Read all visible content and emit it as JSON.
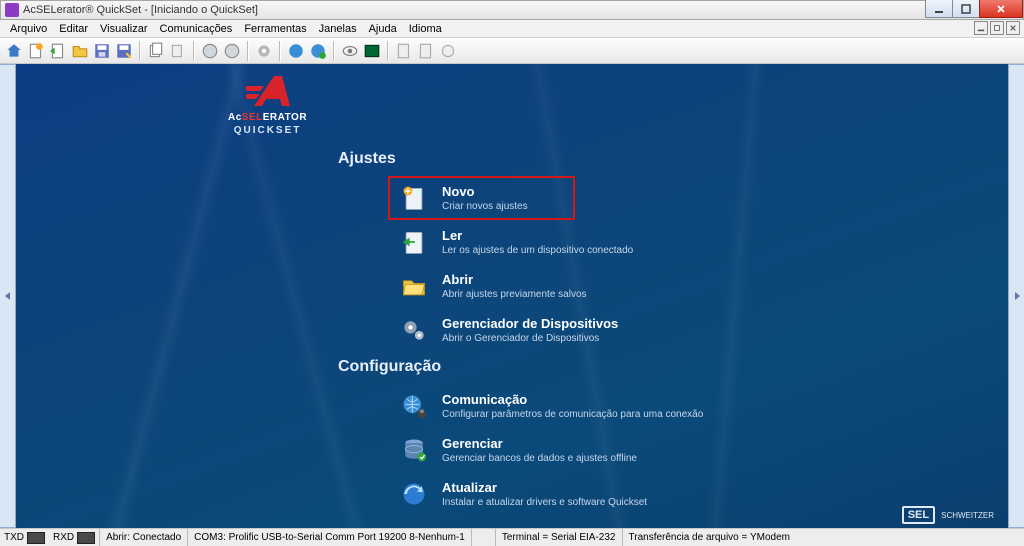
{
  "titlebar": {
    "text": "AcSELerator® QuickSet - [Iniciando o QuickSet]"
  },
  "menu": {
    "arquivo": "Arquivo",
    "editar": "Editar",
    "visualizar": "Visualizar",
    "comunicacoes": "Comunicações",
    "ferramentas": "Ferramentas",
    "janelas": "Janelas",
    "ajuda": "Ajuda",
    "idioma": "Idioma"
  },
  "logo": {
    "brand_prefix": "Ac",
    "brand_accent": "SEL",
    "brand_suffix": "ERATOR",
    "sub": "QUICKSET"
  },
  "sections": {
    "ajustes": {
      "title": "Ajustes",
      "novo": {
        "title": "Novo",
        "desc": "Criar novos ajustes"
      },
      "ler": {
        "title": "Ler",
        "desc": "Ler os ajustes de um dispositivo conectado"
      },
      "abrir": {
        "title": "Abrir",
        "desc": "Abrir ajustes previamente salvos"
      },
      "ger": {
        "title": "Gerenciador de Dispositivos",
        "desc": "Abrir o Gerenciador de Dispositivos"
      }
    },
    "config": {
      "title": "Configuração",
      "com": {
        "title": "Comunicação",
        "desc": "Configurar parâmetros de comunicação para uma conexão"
      },
      "man": {
        "title": "Gerenciar",
        "desc": "Gerenciar bancos de dados e ajustes offline"
      },
      "upd": {
        "title": "Atualizar",
        "desc": "Instalar e atualizar drivers e software Quickset"
      }
    }
  },
  "footer_logo": {
    "brand": "SEL",
    "sub": "SCHWEITZER"
  },
  "status": {
    "txd": "TXD",
    "rxd": "RXD",
    "conn": "Abrir: Conectado",
    "port": "COM3: Prolific USB-to-Serial Comm Port  19200  8-Nenhum-1",
    "term": "Terminal = Serial EIA-232",
    "xfer": "Transferência de arquivo = YModem"
  }
}
